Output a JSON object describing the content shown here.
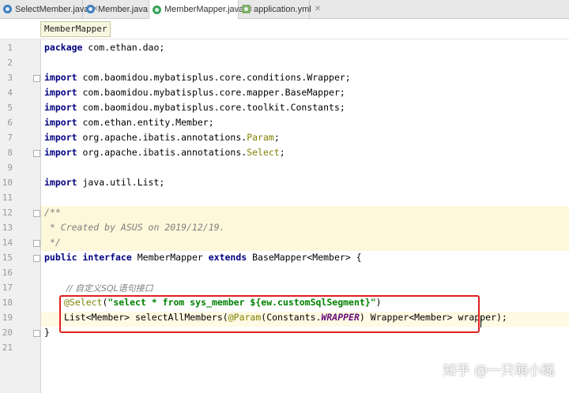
{
  "tabs": [
    {
      "label": "SelectMember.java",
      "icon": "class-icon"
    },
    {
      "label": "Member.java",
      "icon": "class-icon"
    },
    {
      "label": "MemberMapper.java",
      "icon": "interface-icon",
      "active": true
    },
    {
      "label": "application.yml",
      "icon": "yaml-icon"
    }
  ],
  "breadcrumb": "MemberMapper",
  "line_numbers": [
    "1",
    "2",
    "3",
    "4",
    "5",
    "6",
    "7",
    "8",
    "9",
    "10",
    "11",
    "12",
    "13",
    "14",
    "15",
    "16",
    "17",
    "18",
    "19",
    "20",
    "21"
  ],
  "code": {
    "l1": {
      "kw": "package",
      "rest": " com.ethan.dao;"
    },
    "l3": {
      "kw": "import",
      "rest": " com.baomidou.mybatisplus.core.conditions.Wrapper;"
    },
    "l4": {
      "kw": "import",
      "rest": " com.baomidou.mybatisplus.core.mapper.BaseMapper;"
    },
    "l5": {
      "kw": "import",
      "rest": " com.baomidou.mybatisplus.core.toolkit.Constants;"
    },
    "l6": {
      "kw": "import",
      "rest": " com.ethan.entity.Member;"
    },
    "l7": {
      "kw": "import",
      "pre": " org.apache.ibatis.annotations.",
      "ann": "Param",
      "post": ";"
    },
    "l8": {
      "kw": "import",
      "pre": " org.apache.ibatis.annotations.",
      "ann": "Select",
      "post": ";"
    },
    "l10": {
      "kw": "import",
      "rest": " java.util.List;"
    },
    "l12": "/**",
    "l13": " * Created by ASUS on 2019/12/19.",
    "l14": " */",
    "l15": {
      "kw1": "public",
      "kw2": " interface",
      "mid": " MemberMapper ",
      "kw3": "extends",
      "rest": " BaseMapper<Member> {"
    },
    "l17": "// 自定义SQL语句接口",
    "l18": {
      "ann": "@Select",
      "p1": "(",
      "str": "\"select * from sys_member ${ew.customSqlSegment}\"",
      "p2": ")"
    },
    "l19": {
      "pre": "List<Member> selectAllMembers(",
      "ann": "@Param",
      "p1": "(Constants.",
      "cst": "WRAPPER",
      "post": ") Wrapper<Member> wrapper);"
    },
    "l20": "}"
  },
  "watermark": "知乎 @一只萌小璐"
}
